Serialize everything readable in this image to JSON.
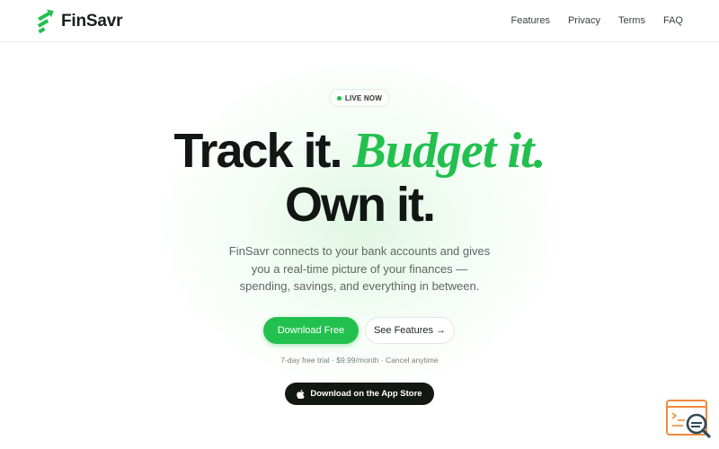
{
  "brand": {
    "name": "FinSavr",
    "accent": "#22c04f",
    "dark": "#141815"
  },
  "nav": {
    "items": [
      {
        "label": "Features"
      },
      {
        "label": "Privacy"
      },
      {
        "label": "Terms"
      },
      {
        "label": "FAQ"
      }
    ]
  },
  "hero": {
    "badge": "LIVE NOW",
    "headline_part1": "Track it.",
    "headline_accent": "Budget it.",
    "headline_part2": "Own it.",
    "subtitle": "FinSavr connects to your bank accounts and gives you a real-time picture of your finances — spending, savings, and everything in between.",
    "primary_cta": "Download Free",
    "secondary_cta": "See Features →",
    "trial_note": "7-day free trial · $9.99/month · Cancel anytime",
    "appstore_cta": "Download on the App Store"
  },
  "icons": {
    "logo": "upward-arrow-logo-icon",
    "appstore": "apple-icon",
    "widget": "search-widget-icon"
  }
}
